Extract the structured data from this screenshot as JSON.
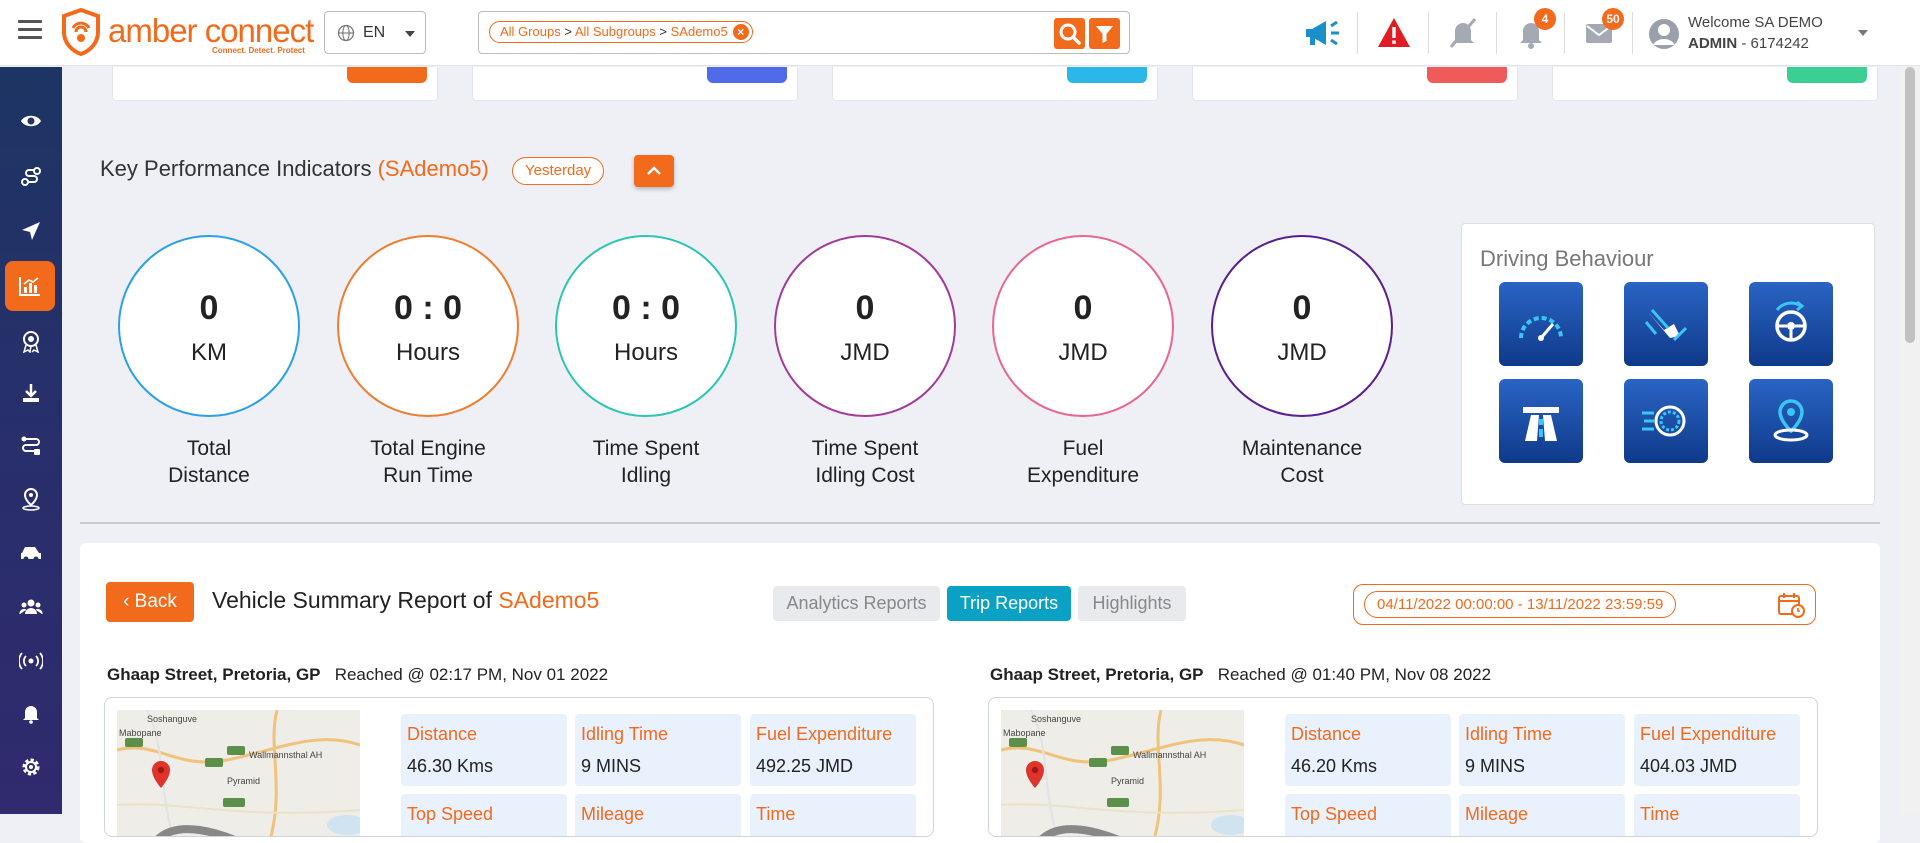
{
  "brand": {
    "name": "amber connect",
    "tagline": "Connect. Detect. Protect",
    "accent": "#f26a1b"
  },
  "language": {
    "code": "EN"
  },
  "filter": {
    "group": "All Groups",
    "subgroup": "All Subgroups",
    "vehicle": "SAdemo5",
    "separator": ">"
  },
  "notifications": {
    "bell_count": "4",
    "mail_count": "50"
  },
  "user": {
    "welcome": "Welcome SA DEMO",
    "role": "ADMIN",
    "id": "- 6174242"
  },
  "sidebar": {
    "items": [
      {
        "icon": "eye-icon"
      },
      {
        "icon": "route-icon"
      },
      {
        "icon": "navigation-icon"
      },
      {
        "icon": "analytics-icon",
        "active": true
      },
      {
        "icon": "award-icon"
      },
      {
        "icon": "download-icon"
      },
      {
        "icon": "trip-icon"
      },
      {
        "icon": "location-person-icon"
      },
      {
        "icon": "vehicle-icon"
      },
      {
        "icon": "users-icon"
      },
      {
        "icon": "broadcast-icon"
      },
      {
        "icon": "alert-bell-icon"
      },
      {
        "icon": "settings-icon"
      }
    ]
  },
  "kpi": {
    "title": "Key Performance Indicators",
    "vehicle": "(SAdemo5)",
    "period": "Yesterday",
    "items": [
      {
        "value": "0",
        "unit": "KM",
        "label1": "Total",
        "label2": "Distance",
        "color": "#2aa0e8"
      },
      {
        "value": "0 : 0",
        "unit": "Hours",
        "label1": "Total Engine",
        "label2": "Run Time",
        "color": "#ef7d2f"
      },
      {
        "value": "0 : 0",
        "unit": "Hours",
        "label1": "Time Spent",
        "label2": "Idling",
        "color": "#2cc5b3"
      },
      {
        "value": "0",
        "unit": "JMD",
        "label1": "Time Spent",
        "label2": "Idling Cost",
        "color": "#a13b9a"
      },
      {
        "value": "0",
        "unit": "JMD",
        "label1": "Fuel",
        "label2": "Expenditure",
        "color": "#e8668f"
      },
      {
        "value": "0",
        "unit": "JMD",
        "label1": "Maintenance",
        "label2": "Cost",
        "color": "#5a1e94"
      }
    ]
  },
  "driving_behaviour": {
    "title": "Driving Behaviour",
    "tiles": [
      "speedometer-icon",
      "harsh-braking-icon",
      "steering-icon",
      "highway-icon",
      "rapid-acceleration-icon",
      "geofence-pin-icon"
    ]
  },
  "report": {
    "back_label": "Back",
    "title": "Vehicle Summary Report of",
    "vehicle": "SAdemo5",
    "tabs": [
      {
        "label": "Analytics Reports",
        "active": false
      },
      {
        "label": "Trip Reports",
        "active": true
      },
      {
        "label": "Highlights",
        "active": false
      }
    ],
    "date_range": "04/11/2022 00:00:00 - 13/11/2022 23:59:59",
    "trips": [
      {
        "place": "Ghaap Street, Pretoria, GP",
        "reached": "Reached @ 02:17 PM, Nov 01 2022",
        "stats": [
          {
            "label": "Distance",
            "value": "46.30 Kms"
          },
          {
            "label": "Idling Time",
            "value": "9 MINS"
          },
          {
            "label": "Fuel Expenditure",
            "value": "492.25 JMD"
          },
          {
            "label": "Top Speed",
            "value": ""
          },
          {
            "label": "Mileage",
            "value": ""
          },
          {
            "label": "Time",
            "value": ""
          }
        ],
        "map_labels": [
          "Soshanguve",
          "Mabopane",
          "Wallmannsthal AH",
          "Pyramid"
        ]
      },
      {
        "place": "Ghaap Street, Pretoria, GP",
        "reached": "Reached @ 01:40 PM, Nov 08 2022",
        "stats": [
          {
            "label": "Distance",
            "value": "46.20 Kms"
          },
          {
            "label": "Idling Time",
            "value": "9 MINS"
          },
          {
            "label": "Fuel Expenditure",
            "value": "404.03 JMD"
          },
          {
            "label": "Top Speed",
            "value": ""
          },
          {
            "label": "Mileage",
            "value": ""
          },
          {
            "label": "Time",
            "value": ""
          }
        ],
        "map_labels": [
          "Soshanguve",
          "Mabopane",
          "Wallmannsthal AH",
          "Pyramid"
        ]
      }
    ]
  }
}
